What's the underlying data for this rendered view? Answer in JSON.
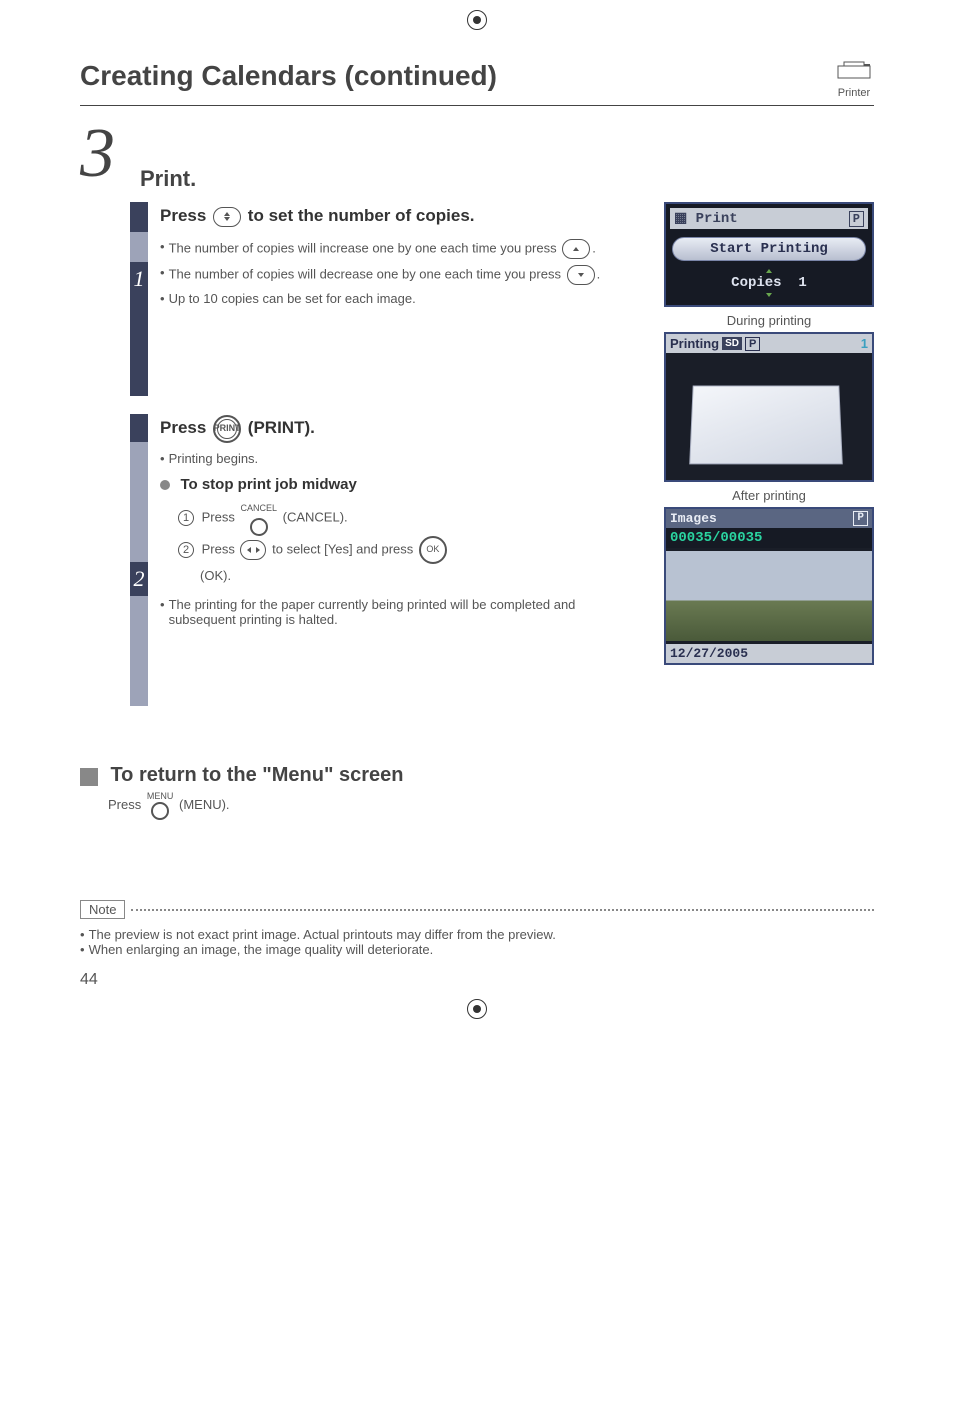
{
  "header": {
    "title": "Creating Calendars (continued)",
    "iconLabel": "Printer"
  },
  "step": {
    "number": "3",
    "title": "Print."
  },
  "sub1": {
    "num": "1",
    "mainA": "Press",
    "mainB": "to set the number of copies.",
    "b1a": "The number of copies will increase one by one each time you press",
    "b2a": "The number of copies will decrease one by one each time you press",
    "b3": "Up to 10 copies can be set for each image."
  },
  "sub2": {
    "num": "2",
    "mainA": "Press",
    "mainB": "(PRINT).",
    "b1": "Printing begins.",
    "stopHead": "To stop print job midway",
    "s1a": "Press",
    "s1b": "(CANCEL).",
    "s2a": "Press",
    "s2b": "to select [Yes] and press",
    "s2c": "(OK).",
    "b2": "The printing for the paper currently being printed will be completed and subsequent printing is halted."
  },
  "screens": {
    "printTitle": "Print",
    "startPrinting": "Start Printing",
    "copiesLabel": "Copies",
    "copiesVal": "1",
    "duringCaption": "During printing",
    "printingLabel": "Printing",
    "sd": "SD",
    "p": "P",
    "one": "1",
    "afterCaption": "After printing",
    "imagesLabel": "Images",
    "imagesCount": "00035/00035",
    "date": "12/27/2005"
  },
  "returnSection": {
    "title": "To return to the \"Menu\" screen",
    "textA": "Press",
    "textB": "(MENU)."
  },
  "labels": {
    "cancel": "CANCEL",
    "menu": "MENU",
    "print": "PRINT",
    "ok": "OK"
  },
  "note": {
    "label": "Note",
    "n1": "The preview is not exact print image. Actual printouts may differ from the preview.",
    "n2": "When enlarging an image, the image quality will deteriorate."
  },
  "pageNumber": "44"
}
